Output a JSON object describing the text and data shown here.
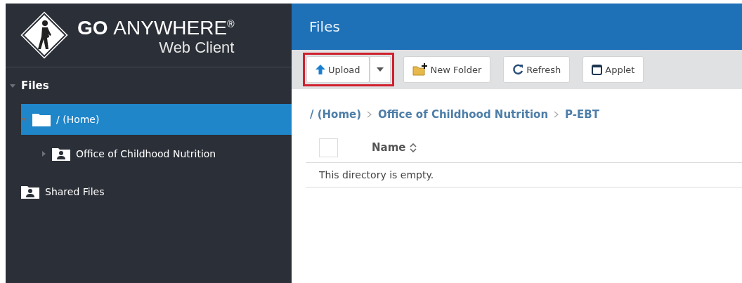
{
  "logo": {
    "brand_bold": "GO",
    "brand_light": "ANYWHERE",
    "trademark": "®",
    "product": "Web Client"
  },
  "sidebar": {
    "tree": [
      {
        "label": "Files",
        "kind": "section",
        "expanded": true,
        "selected": false,
        "children": [
          {
            "label": "/ (Home)",
            "kind": "folder",
            "expanded": true,
            "selected": true,
            "children": [
              {
                "label": "Office of Childhood Nutrition",
                "kind": "shared",
                "expanded": false,
                "selected": false
              }
            ]
          },
          {
            "label": "Shared Files",
            "kind": "shared",
            "selected": false
          }
        ]
      }
    ]
  },
  "header": {
    "title": "Files"
  },
  "toolbar": {
    "buttons": [
      {
        "label": "Upload",
        "kind": "upload",
        "highlighted": true
      },
      {
        "label": "New Folder",
        "kind": "new-folder",
        "highlighted": false
      },
      {
        "label": "Refresh",
        "kind": "refresh",
        "highlighted": false
      },
      {
        "label": "Applet",
        "kind": "applet",
        "highlighted": false
      }
    ]
  },
  "breadcrumbs": [
    "/ (Home)",
    "Office of Childhood Nutrition",
    "P-EBT"
  ],
  "table": {
    "columns": [
      {
        "label": "Name",
        "sortable": true
      }
    ],
    "select_all_checked": false,
    "empty_message": "This directory is empty."
  }
}
